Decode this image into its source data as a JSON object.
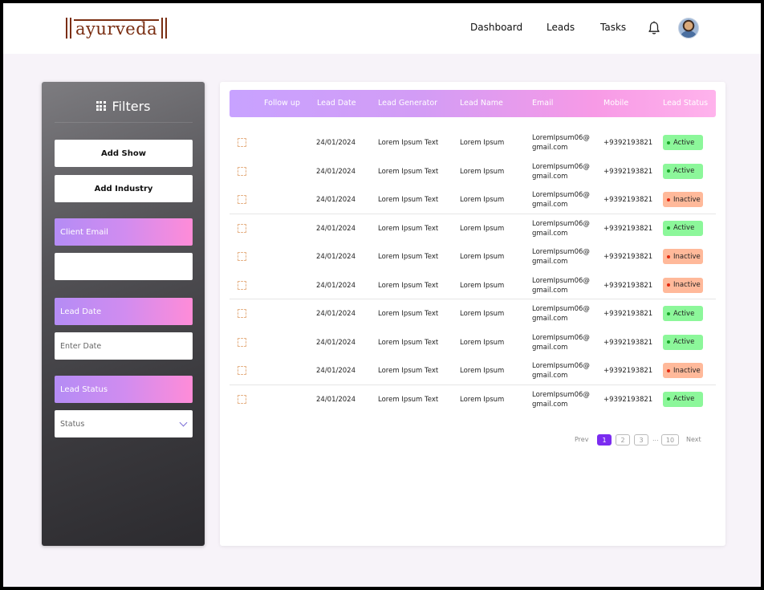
{
  "brand": {
    "logo_text": "ayurveda"
  },
  "nav": {
    "dashboard": "Dashboard",
    "leads": "Leads",
    "tasks": "Tasks"
  },
  "sidebar": {
    "title": "Filters",
    "add_show": "Add Show",
    "add_industry": "Add Industry",
    "client_email_label": "Client Email",
    "client_email_value": "",
    "lead_date_label": "Lead Date",
    "lead_date_placeholder": "Enter Date",
    "lead_status_label": "Lead Status",
    "status_selected": "Status"
  },
  "table": {
    "headers": [
      "Follow up",
      "Lead Date",
      "Lead Generator",
      "Lead Name",
      "Email",
      "Mobile",
      "Lead Status"
    ],
    "rows": [
      {
        "date": "24/01/2024",
        "generator": "Lorem Ipsum Text",
        "name": "Lorem Ipsum",
        "email_1": "LoremIpsum06@",
        "email_2": "gmail.com",
        "mobile": "+9392193821",
        "status": "Active"
      },
      {
        "date": "24/01/2024",
        "generator": "Lorem Ipsum Text",
        "name": "Lorem Ipsum",
        "email_1": "LoremIpsum06@",
        "email_2": "gmail.com",
        "mobile": "+9392193821",
        "status": "Active"
      },
      {
        "date": "24/01/2024",
        "generator": "Lorem Ipsum Text",
        "name": "Lorem Ipsum",
        "email_1": "LoremIpsum06@",
        "email_2": "gmail.com",
        "mobile": "+9392193821",
        "status": "Inactive"
      },
      {
        "date": "24/01/2024",
        "generator": "Lorem Ipsum Text",
        "name": "Lorem Ipsum",
        "email_1": "LoremIpsum06@",
        "email_2": "gmail.com",
        "mobile": "+9392193821",
        "status": "Active"
      },
      {
        "date": "24/01/2024",
        "generator": "Lorem Ipsum Text",
        "name": "Lorem Ipsum",
        "email_1": "LoremIpsum06@",
        "email_2": "gmail.com",
        "mobile": "+9392193821",
        "status": "Inactive"
      },
      {
        "date": "24/01/2024",
        "generator": "Lorem Ipsum Text",
        "name": "Lorem Ipsum",
        "email_1": "LoremIpsum06@",
        "email_2": "gmail.com",
        "mobile": "+9392193821",
        "status": "Inactive"
      },
      {
        "date": "24/01/2024",
        "generator": "Lorem Ipsum Text",
        "name": "Lorem Ipsum",
        "email_1": "LoremIpsum06@",
        "email_2": "gmail.com",
        "mobile": "+9392193821",
        "status": "Active"
      },
      {
        "date": "24/01/2024",
        "generator": "Lorem Ipsum Text",
        "name": "Lorem Ipsum",
        "email_1": "LoremIpsum06@",
        "email_2": "gmail.com",
        "mobile": "+9392193821",
        "status": "Active"
      },
      {
        "date": "24/01/2024",
        "generator": "Lorem Ipsum Text",
        "name": "Lorem Ipsum",
        "email_1": "LoremIpsum06@",
        "email_2": "gmail.com",
        "mobile": "+9392193821",
        "status": "Inactive"
      },
      {
        "date": "24/01/2024",
        "generator": "Lorem Ipsum Text",
        "name": "Lorem Ipsum",
        "email_1": "LoremIpsum06@",
        "email_2": "gmail.com",
        "mobile": "+9392193821",
        "status": "Active"
      }
    ]
  },
  "pagination": {
    "prev": "Prev",
    "pages": [
      "1",
      "2",
      "3"
    ],
    "ellipsis": "...",
    "last": "10",
    "next": "Next",
    "current": "1"
  },
  "icons": {
    "bell": "bell-icon",
    "filters": "grid-icon",
    "chevron": "chevron-down-icon",
    "avatar": "avatar"
  },
  "colors": {
    "brand": "#7a2e12",
    "accent": "#7b2cf0",
    "active_badge": "#8cf79a",
    "inactive_badge": "#ffb99a"
  }
}
